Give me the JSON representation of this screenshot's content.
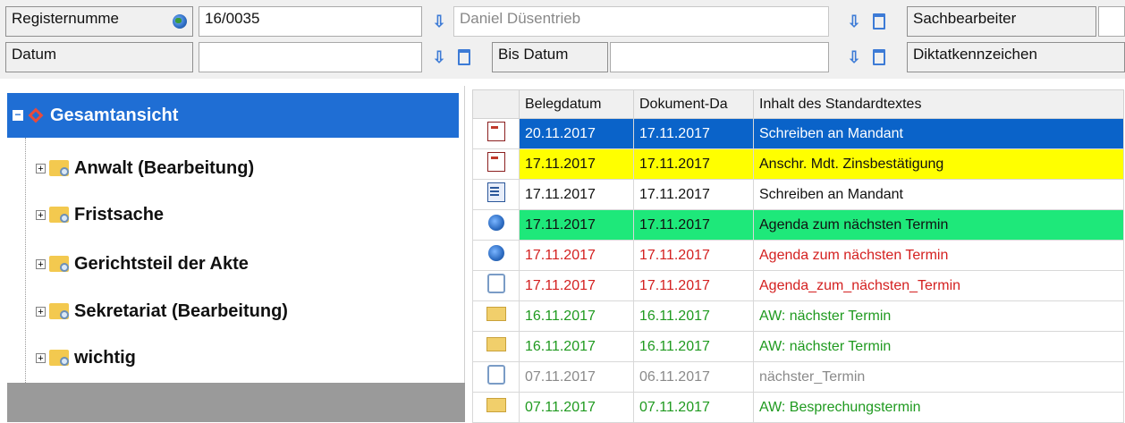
{
  "top": {
    "row1": {
      "registernummer_label": "Registernumme",
      "registernummer_value": "16/0035",
      "name_value": "Daniel Düsentrieb",
      "sachbearbeiter_label": "Sachbearbeiter"
    },
    "row2": {
      "datum_label": "Datum",
      "datum_value": "",
      "bis_datum_label": "Bis Datum",
      "bis_datum_value": "",
      "diktat_label": "Diktatkennzeichen"
    }
  },
  "tree": {
    "root": "Gesamtansicht",
    "nodes": [
      {
        "label": "Anwalt (Bearbeitung)"
      },
      {
        "label": "Fristsache"
      },
      {
        "label": "Gerichtsteil der Akte"
      },
      {
        "label": "Sekretariat (Bearbeitung)"
      },
      {
        "label": "wichtig"
      }
    ]
  },
  "grid": {
    "headers": [
      "",
      "Belegdatum",
      "Dokument-Da",
      "Inhalt des Standardtextes"
    ],
    "rows": [
      {
        "icon": "pdf-icon",
        "beleg": "20.11.2017",
        "dok": "17.11.2017",
        "text": "Schreiben an Mandant",
        "bg": "#0a63c9",
        "fg": "#ffffff"
      },
      {
        "icon": "pdf-icon",
        "beleg": "17.11.2017",
        "dok": "17.11.2017",
        "text": "Anschr. Mdt. Zinsbestätigung",
        "bg": "#ffff00",
        "fg": "#111111"
      },
      {
        "icon": "word-icon",
        "beleg": "17.11.2017",
        "dok": "17.11.2017",
        "text": "Schreiben an Mandant",
        "bg": "#ffffff",
        "fg": "#111111"
      },
      {
        "icon": "globe-icon",
        "beleg": "17.11.2017",
        "dok": "17.11.2017",
        "text": "Agenda zum nächsten Termin",
        "bg": "#1ee87a",
        "fg": "#111111"
      },
      {
        "icon": "globe-icon",
        "beleg": "17.11.2017",
        "dok": "17.11.2017",
        "text": "Agenda zum nächsten Termin",
        "bg": "#ffffff",
        "fg": "#d42020"
      },
      {
        "icon": "blank-doc-icon",
        "beleg": "17.11.2017",
        "dok": "17.11.2017",
        "text": "Agenda_zum_nächsten_Termin",
        "bg": "#ffffff",
        "fg": "#d42020"
      },
      {
        "icon": "mail-icon",
        "beleg": "16.11.2017",
        "dok": "16.11.2017",
        "text": "AW: nächster Termin",
        "bg": "#ffffff",
        "fg": "#1f9a1f"
      },
      {
        "icon": "mail-icon",
        "beleg": "16.11.2017",
        "dok": "16.11.2017",
        "text": "AW: nächster Termin",
        "bg": "#ffffff",
        "fg": "#1f9a1f"
      },
      {
        "icon": "blank-doc-icon",
        "beleg": "07.11.2017",
        "dok": "06.11.2017",
        "text": "nächster_Termin",
        "bg": "#ffffff",
        "fg": "#8a8a8a"
      },
      {
        "icon": "mail-icon",
        "beleg": "07.11.2017",
        "dok": "07.11.2017",
        "text": "AW: Besprechungstermin",
        "bg": "#ffffff",
        "fg": "#1f9a1f"
      }
    ]
  }
}
